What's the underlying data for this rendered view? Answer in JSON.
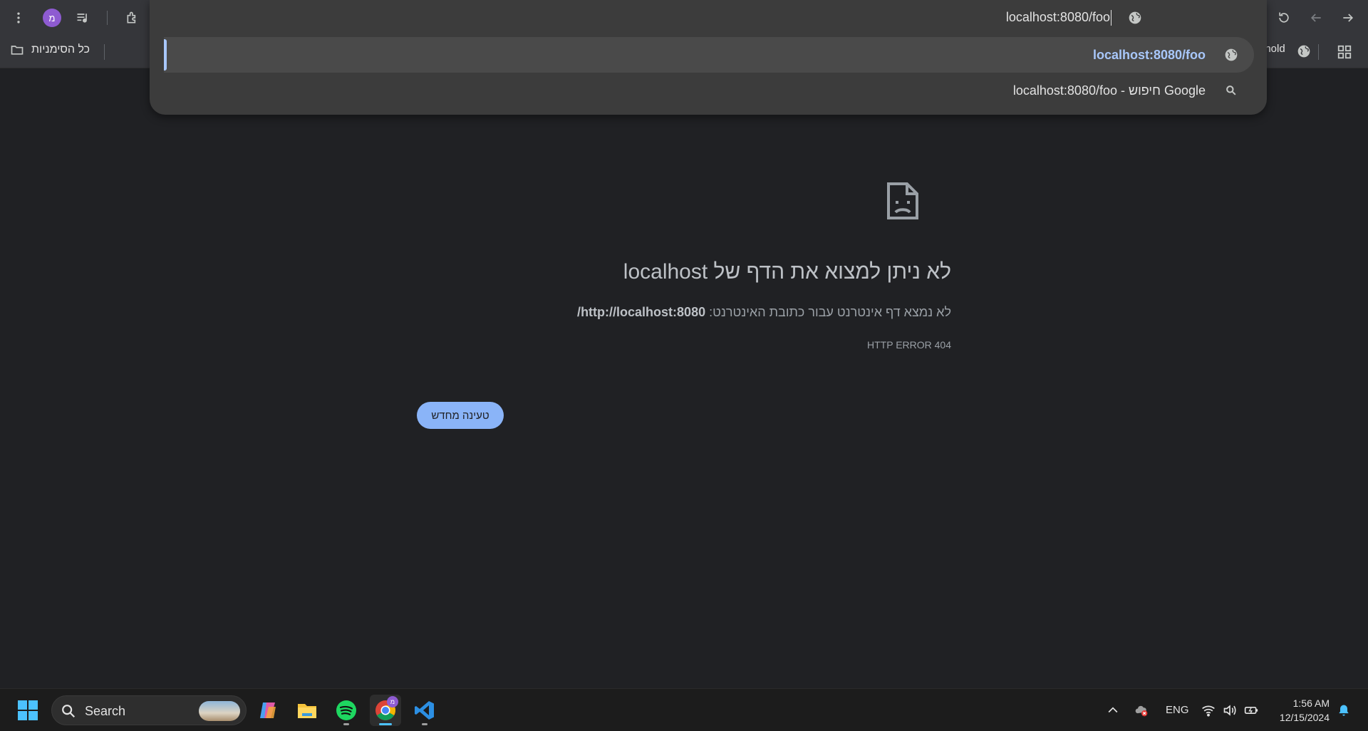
{
  "omnibox": {
    "text": "localhost:8080/foo",
    "suggestions": [
      {
        "text": "localhost:8080/foo",
        "icon": "globe-icon",
        "selected": true
      },
      {
        "text": "localhost:8080/foo - חיפוש Google",
        "icon": "search-icon",
        "selected": false
      }
    ]
  },
  "toolbar": {
    "avatar_letter": "מ"
  },
  "bookmarks": {
    "all_bookmarks": "כל הסימניות",
    "partial_right": "ehold"
  },
  "error_page": {
    "title": "לא ניתן למצוא את הדף של localhost",
    "message_prefix": "לא נמצא דף אינטרנט עבור כתובת האינטרנט: ",
    "message_url": "http://localhost:8080/",
    "error_code": "HTTP ERROR 404",
    "reload_label": "טעינה מחדש"
  },
  "taskbar": {
    "search_label": "Search",
    "language": "ENG",
    "time": "1:56 AM",
    "date": "12/15/2024",
    "chrome_badge": "מ"
  },
  "colors": {
    "page_bg": "#202124",
    "accent": "#8ab4f8",
    "omnibox_link": "#a8c7fa"
  }
}
